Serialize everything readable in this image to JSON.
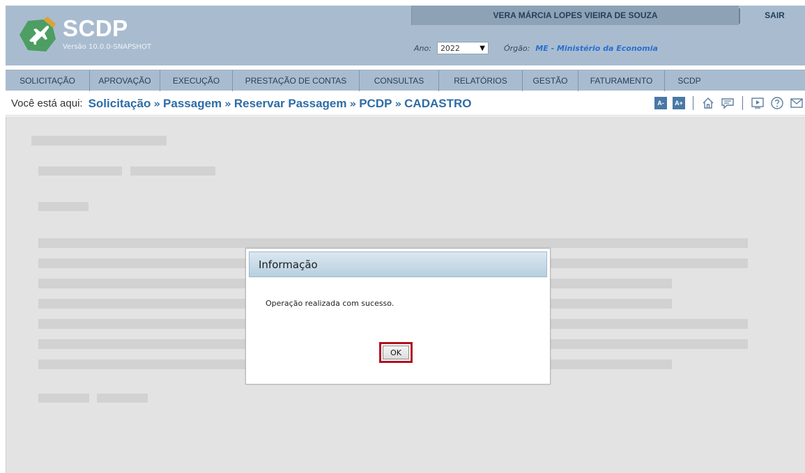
{
  "header": {
    "app_name": "SCDP",
    "version": "Versão 10.0.0-SNAPSHOT",
    "user_name": "VERA MÁRCIA LOPES VIEIRA DE SOUZA",
    "logout_label": "SAIR",
    "year_label": "Ano:",
    "year_value": "2022",
    "org_label": "Órgão:",
    "org_value": "ME - Ministério da Economia"
  },
  "menu": {
    "items": [
      {
        "label": "SOLICITAÇÃO"
      },
      {
        "label": "APROVAÇÃO"
      },
      {
        "label": "EXECUÇÃO"
      },
      {
        "label": "PRESTAÇÃO DE CONTAS"
      },
      {
        "label": "CONSULTAS"
      },
      {
        "label": "RELATÓRIOS"
      },
      {
        "label": "GESTÃO"
      },
      {
        "label": "FATURAMENTO"
      },
      {
        "label": "SCDP"
      }
    ]
  },
  "breadcrumb": {
    "prefix": "Você está aqui:",
    "items": [
      "Solicitação",
      "Passagem",
      "Reservar Passagem",
      "PCDP",
      "CADASTRO"
    ],
    "separator": "»"
  },
  "tools": {
    "font_decrease": "A-",
    "font_increase": "A+",
    "icons": [
      "home-icon",
      "chat-icon",
      "video-icon",
      "help-icon",
      "mail-icon"
    ]
  },
  "modal": {
    "title": "Informação",
    "message": "Operação realizada com sucesso.",
    "ok_label": "OK"
  },
  "colors": {
    "header_bg": "#a9bccf",
    "accent": "#2d6ca6",
    "highlight_border": "#b3121f"
  }
}
